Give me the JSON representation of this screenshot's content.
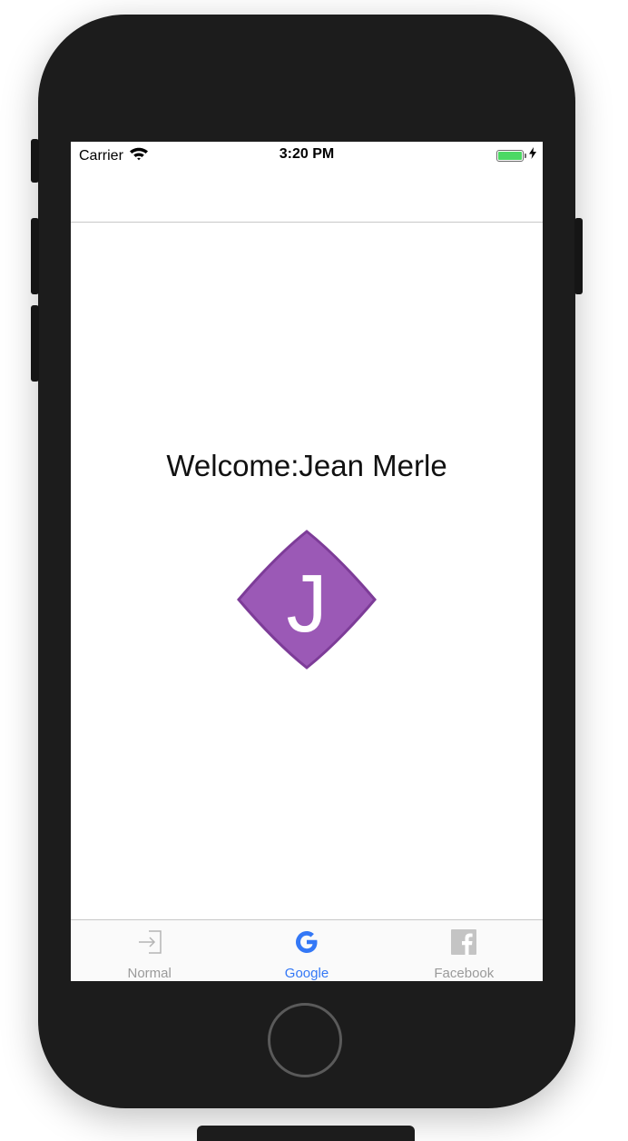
{
  "status_bar": {
    "carrier": "Carrier",
    "time": "3:20 PM"
  },
  "main": {
    "welcome_text": "Welcome:Jean Merle",
    "avatar_initial": "J",
    "avatar_color": "#9b59b6",
    "avatar_border_color": "#7d3c98"
  },
  "tab_bar": {
    "active_color": "#3478f6",
    "inactive_color": "#9a9a9a",
    "tabs": [
      {
        "label": "Normal",
        "icon": "login-arrow-icon",
        "active": false
      },
      {
        "label": "Google",
        "icon": "google-icon",
        "active": true
      },
      {
        "label": "Facebook",
        "icon": "facebook-icon",
        "active": false
      }
    ]
  }
}
